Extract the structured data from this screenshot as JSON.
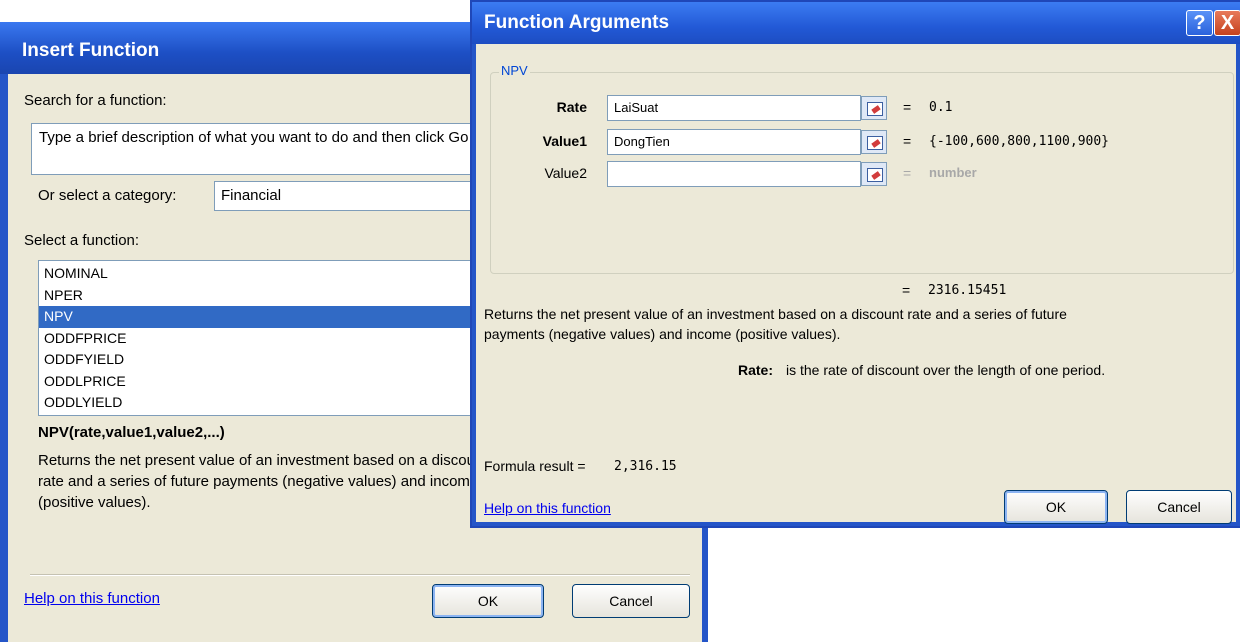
{
  "insert_function": {
    "title": "Insert Function",
    "search_label": "Search for a function:",
    "search_value": "Type a brief description of what you want to do and then click Go",
    "category_label": "Or select a category:",
    "category_value": "Financial",
    "select_label": "Select a function:",
    "functions": [
      "NOMINAL",
      "NPER",
      "NPV",
      "ODDFPRICE",
      "ODDFYIELD",
      "ODDLPRICE",
      "ODDLYIELD"
    ],
    "selected_function": "NPV",
    "signature": "NPV(rate,value1,value2,...)",
    "description": "Returns the net present value of an investment based on a discount rate and a series of future payments (negative values) and income (positive values).",
    "help_link": "Help on this function",
    "ok_label": "OK",
    "cancel_label": "Cancel"
  },
  "function_arguments": {
    "title": "Function Arguments",
    "help_button": "?",
    "close_button": "X",
    "group_label": "NPV",
    "args": [
      {
        "label": "Rate",
        "value": "LaiSuat",
        "result": "0.1",
        "bold": true
      },
      {
        "label": "Value1",
        "value": "DongTien",
        "result": "{-100,600,800,1100,900}",
        "bold": true
      },
      {
        "label": "Value2",
        "value": "",
        "result": "number",
        "bold": false
      }
    ],
    "equals": "=",
    "total_result": "2316.15451",
    "description_line1": "Returns the net present value of an investment based on a discount rate and a series of future",
    "description_line2": "payments (negative values) and income (positive values).",
    "arg_help_name": "Rate:",
    "arg_help_text": "is the rate of discount over the length of one period.",
    "formula_result_label": "Formula result =",
    "formula_result_value": "2,316.15",
    "help_link": "Help on this function",
    "ok_label": "OK",
    "cancel_label": "Cancel",
    "colors": {
      "title_bar": "#2455c8",
      "dialog_bg": "#ece9d8",
      "selection": "#316ac5",
      "link": "#0000ee"
    }
  }
}
